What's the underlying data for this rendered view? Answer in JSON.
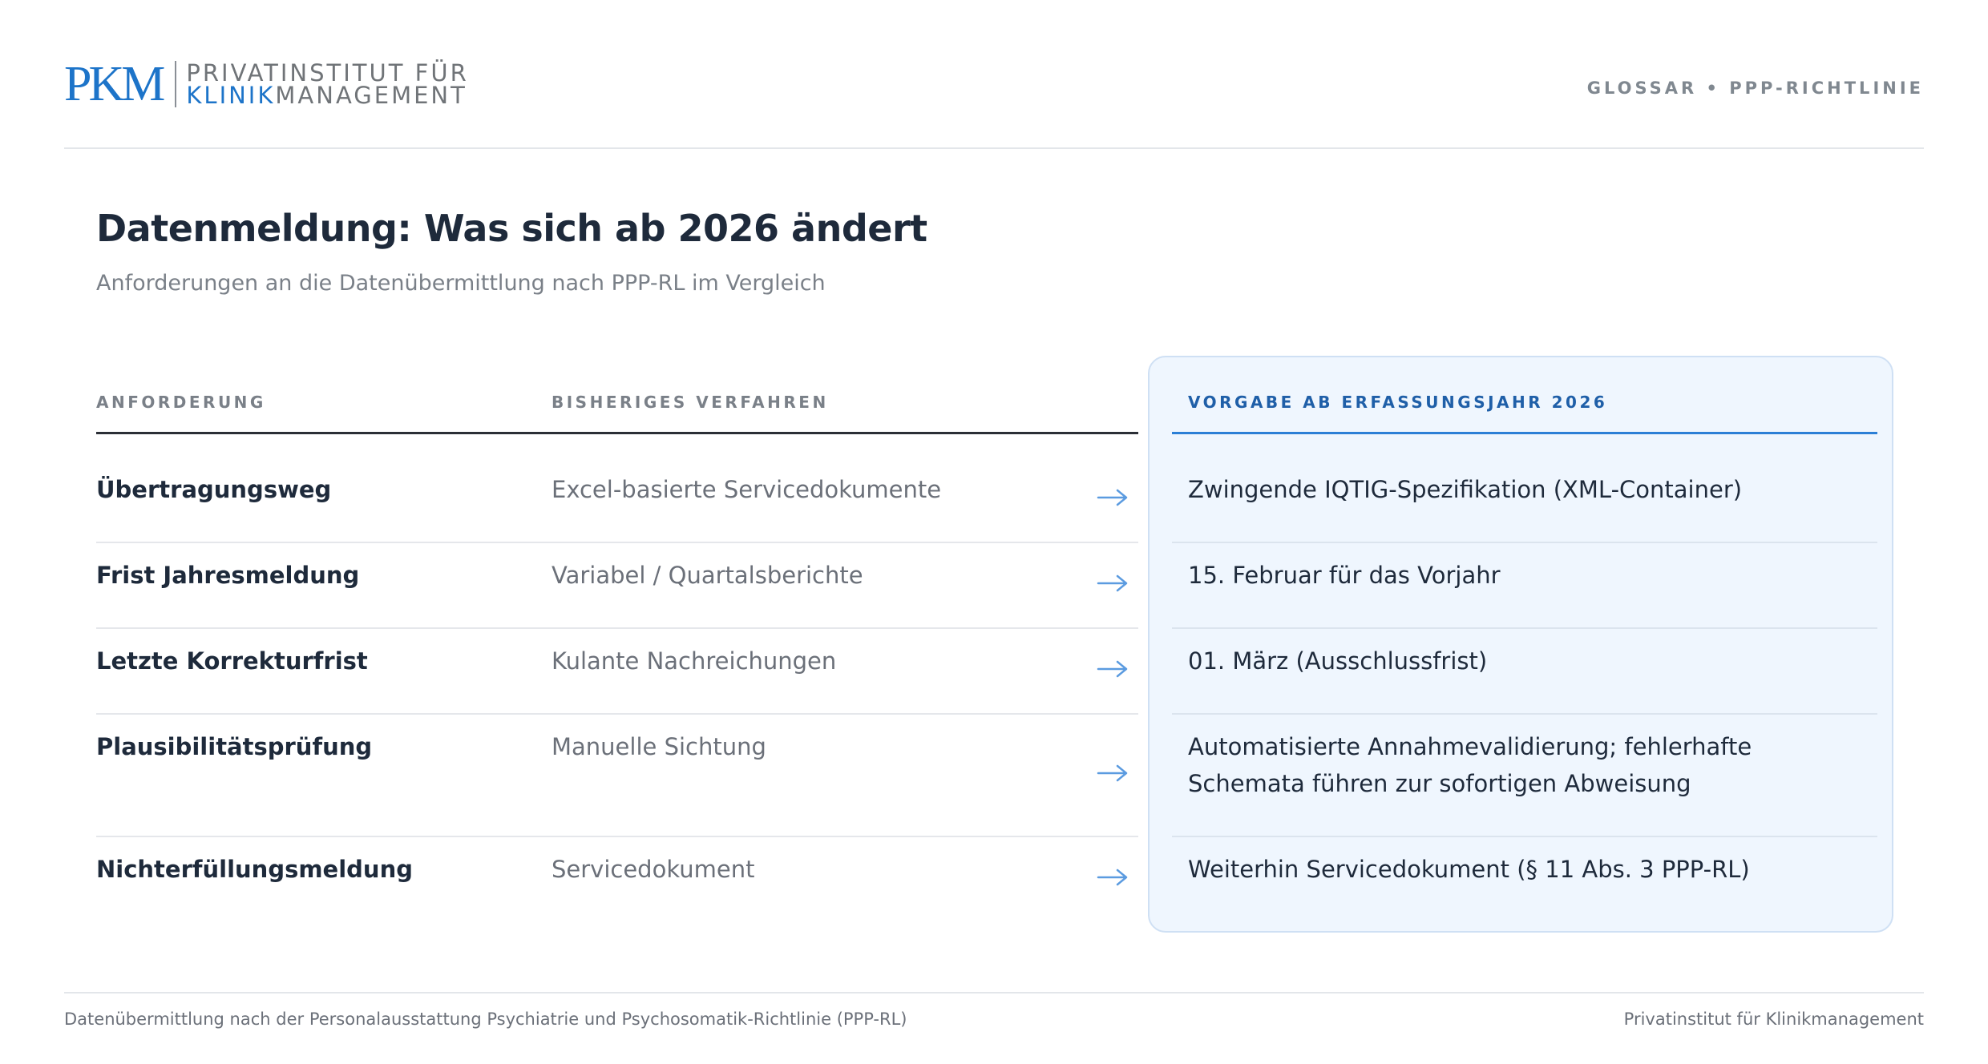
{
  "header": {
    "logo_mark": "PKM",
    "logo_line1": "PRIVATINSTITUT FÜR",
    "logo_line2_highlight": "KLINIK",
    "logo_line2_rest": "MANAGEMENT",
    "section": "GLOSSAR • PPP-RICHTLINIE"
  },
  "title": "Datenmeldung: Was sich ab 2026 ändert",
  "subtitle": "Anforderungen an die Datenübermittlung nach PPP-RL im Vergleich",
  "table": {
    "headers": {
      "requirement": "ANFORDERUNG",
      "previous": "BISHERIGES VERFAHREN",
      "new": "VORGABE AB ERFASSUNGSJAHR 2026"
    },
    "rows": [
      {
        "requirement": "Übertragungsweg",
        "previous": "Excel-basierte Servicedokumente",
        "new": "Zwingende IQTIG-Spezifikation (XML-Container)"
      },
      {
        "requirement": "Frist Jahresmeldung",
        "previous": "Variabel / Quartalsberichte",
        "new": "15. Februar für das Vorjahr"
      },
      {
        "requirement": "Letzte Korrekturfrist",
        "previous": "Kulante Nachreichungen",
        "new": "01. März (Ausschlussfrist)"
      },
      {
        "requirement": "Plausibilitätsprüfung",
        "previous": "Manuelle Sichtung",
        "new": "Automatisierte Annahmevalidierung; fehlerhafte Schemata führen zur sofortigen Abweisung"
      },
      {
        "requirement": "Nichterfüllungsmeldung",
        "previous": "Servicedokument",
        "new": "Weiterhin Servicedokument (§ 11 Abs. 3 PPP-RL)"
      }
    ]
  },
  "footer": {
    "left": "Datenübermittlung nach der Personalausstattung Psychiatrie und Psychosomatik-Richtlinie (PPP-RL)",
    "right": "Privatinstitut für Klinikmanagement"
  },
  "colors": {
    "accent": "#1d74c9",
    "panel_bg": "#eff6fe",
    "arrow": "#5b9be0"
  }
}
